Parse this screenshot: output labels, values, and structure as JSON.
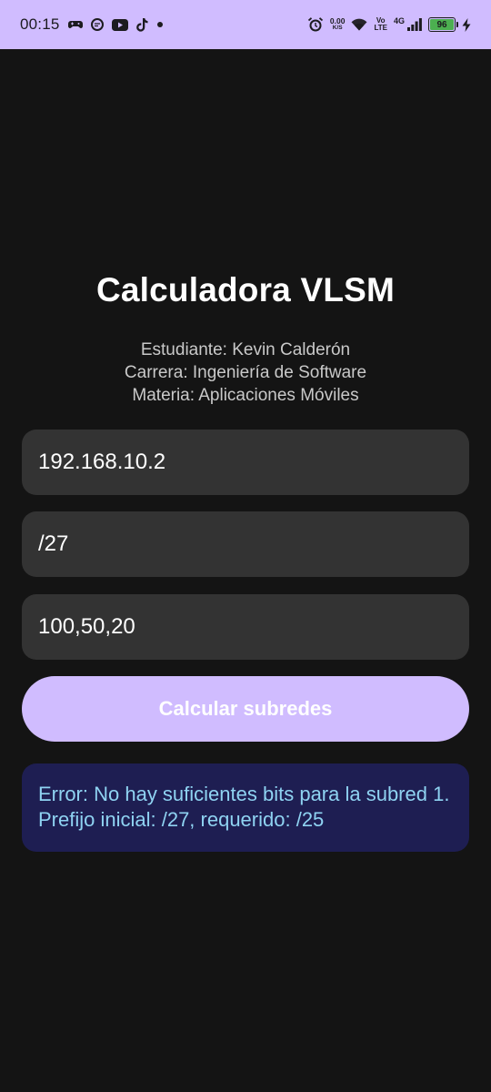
{
  "status_bar": {
    "time": "00:15",
    "speed_value": "0.00",
    "speed_unit": "K/S",
    "volte_top": "Vo",
    "volte_bottom": "LTE",
    "network": "4G",
    "battery": "96",
    "left_icons": [
      "game-controller-icon",
      "chat-app-icon",
      "youtube-icon",
      "tiktok-icon",
      "dot-icon"
    ],
    "right_icons": [
      "alarm-icon",
      "wifi-icon",
      "signal-icon",
      "charging-bolt-icon"
    ],
    "colors": {
      "bar_bg": "#d0bcff",
      "battery_fill": "#4caf50"
    }
  },
  "app": {
    "title": "Calculadora VLSM",
    "student": "Estudiante: Kevin Calderón",
    "career": "Carrera: Ingeniería de Software",
    "subject": "Materia: Aplicaciones Móviles"
  },
  "form": {
    "ip_value": "192.168.10.2",
    "prefix_value": "/27",
    "hosts_value": "100,50,20",
    "calculate_label": "Calcular subredes"
  },
  "result": {
    "error_text": "Error: No hay suficientes bits para la subred 1. Prefijo inicial: /27, requerido: /25"
  },
  "colors": {
    "background": "#141414",
    "field_bg": "#333333",
    "button_bg": "#d0bcff",
    "error_bg": "#1e1e52",
    "error_text": "#8fd3f2"
  }
}
